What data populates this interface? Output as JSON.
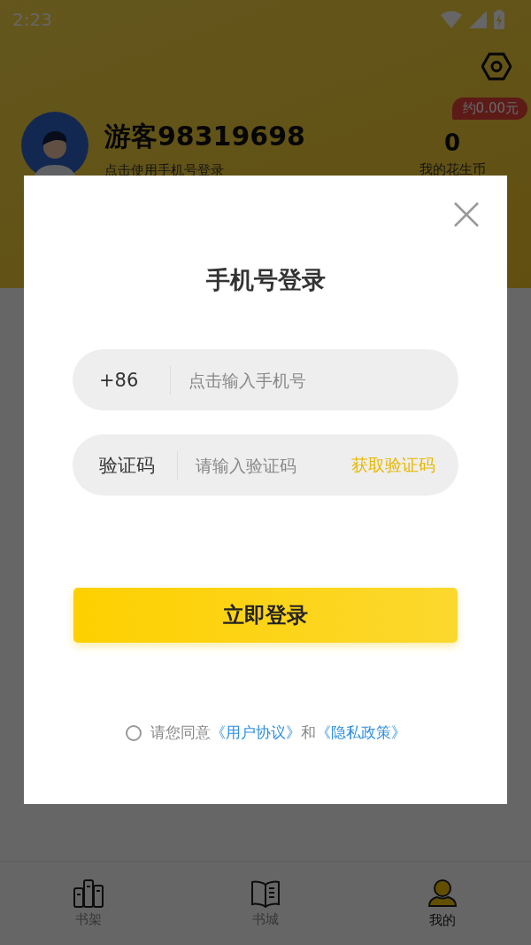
{
  "status_bar": {
    "time": "2:23"
  },
  "profile": {
    "name": "游客98319698",
    "subtitle": "点击使用手机号登录",
    "coins": {
      "badge": "约0.00元",
      "value": "0",
      "label": "我的花生币"
    }
  },
  "nav": [
    {
      "label": "书架",
      "kind": "shelf",
      "selected": false
    },
    {
      "label": "书城",
      "kind": "book",
      "selected": false
    },
    {
      "label": "我的",
      "kind": "person",
      "selected": true
    }
  ],
  "dialog": {
    "title": "手机号登录",
    "phone": {
      "prefix": "+86",
      "placeholder": "点击输入手机号"
    },
    "code": {
      "label": "验证码",
      "placeholder": "请输入验证码",
      "action": "获取验证码"
    },
    "submit": "立即登录",
    "agreement": {
      "checked": false,
      "parts": [
        {
          "kind": "text",
          "text": "请您同意"
        },
        {
          "kind": "link",
          "text": "《用户协议》"
        },
        {
          "kind": "text",
          "text": "和"
        },
        {
          "kind": "link",
          "text": "《隐私政策》"
        }
      ]
    }
  }
}
